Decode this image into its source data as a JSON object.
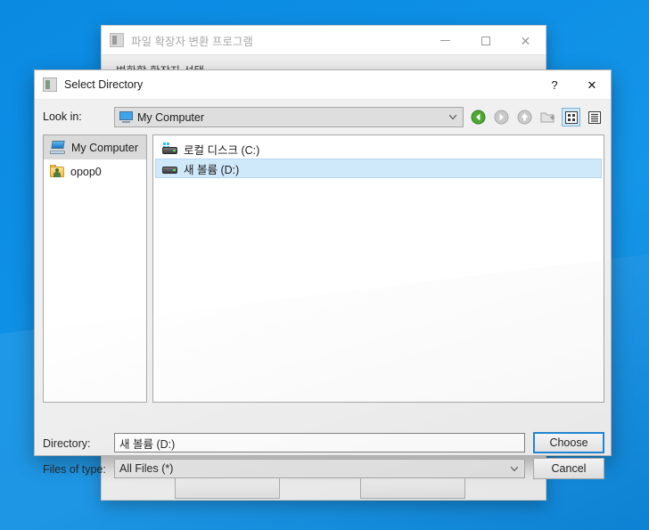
{
  "desktop": {
    "background_color": "#0e90e6"
  },
  "app_window": {
    "title": "파일 확장자 변환 프로그램",
    "icon": "app-icon",
    "section_label": "변환할 확장자 선택",
    "window_controls": {
      "minimize": "minimize-icon",
      "maximize": "maximize-icon",
      "close": "close-icon"
    },
    "buttons": [
      {
        "label": ""
      },
      {
        "label": ""
      }
    ]
  },
  "dialog": {
    "title": "Select Directory",
    "icon": "folder-icon",
    "window_controls": {
      "help": "?",
      "close": "✕"
    },
    "lookin": {
      "label": "Look in:",
      "value": "My Computer",
      "icon": "computer-icon",
      "arrow": "chevron-down-icon"
    },
    "toolbar": [
      {
        "name": "back-icon",
        "title": "Back",
        "state": "enabled"
      },
      {
        "name": "forward-icon",
        "title": "Forward",
        "state": "disabled"
      },
      {
        "name": "parent-dir-icon",
        "title": "Parent Directory",
        "state": "disabled"
      },
      {
        "name": "new-folder-icon",
        "title": "Create New Folder",
        "state": "disabled"
      },
      {
        "name": "list-view-icon",
        "title": "List View",
        "state": "active"
      },
      {
        "name": "detail-view-icon",
        "title": "Detail View",
        "state": "enabled"
      }
    ],
    "sidebar": [
      {
        "label": "My Computer",
        "icon": "computer-icon",
        "selected": true
      },
      {
        "label": "opop0",
        "icon": "user-folder-icon",
        "selected": false
      }
    ],
    "files": [
      {
        "label": "로컬 디스크 (C:)",
        "icon": "system-drive-icon",
        "selected": false
      },
      {
        "label": "새 볼륨 (D:)",
        "icon": "drive-icon",
        "selected": true
      }
    ],
    "directory": {
      "label": "Directory:",
      "value": "새 볼륨 (D:)"
    },
    "files_of_type": {
      "label": "Files of type:",
      "value": "All Files (*)",
      "arrow": "chevron-down-icon"
    },
    "choose_button": "Choose",
    "cancel_button": "Cancel",
    "accent_color": "#1a86d6",
    "selection_color": "#cfe8fa"
  }
}
